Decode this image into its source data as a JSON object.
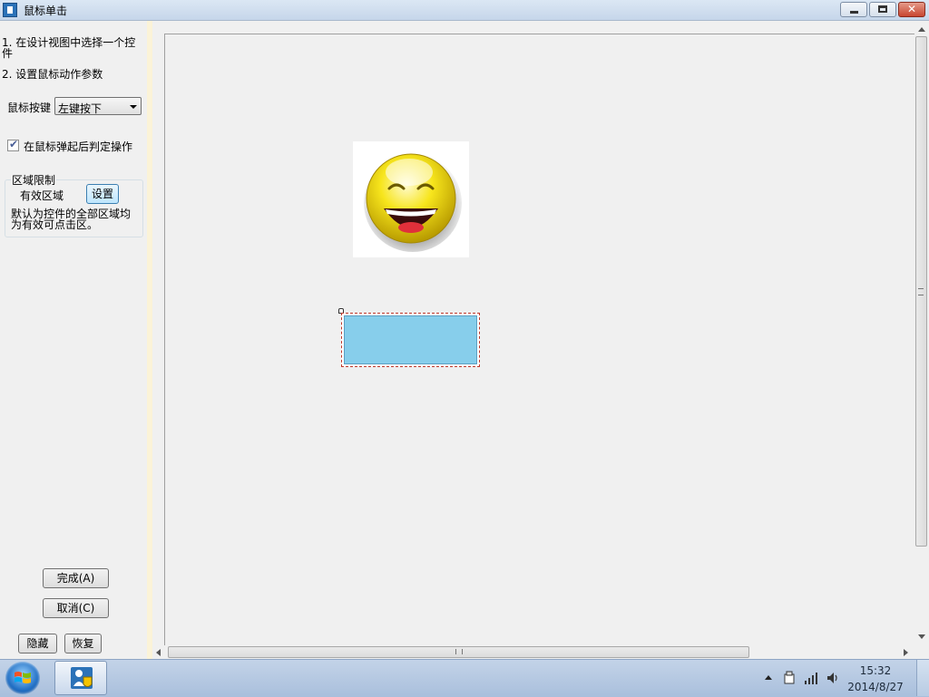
{
  "window": {
    "title": "鼠标单击"
  },
  "left_panel": {
    "step1": "1. 在设计视图中选择一个控件",
    "step2": "2. 设置鼠标动作参数",
    "mouse_key_label": "鼠标按键",
    "mouse_key_value": "左键按下",
    "release_checkbox_label": "在鼠标弹起后判定操作",
    "release_checked": true,
    "region_group_title": "区域限制",
    "valid_region_label": "有效区域",
    "set_button": "设置",
    "region_desc": "默认为控件的全部区域均为有效可点击区。",
    "finish_button": "完成(A)",
    "cancel_button": "取消(C)",
    "hide_button": "隐藏",
    "restore_button": "恢复"
  },
  "canvas": {
    "rect_fill": "#87ceeb",
    "rect_selection_border": "#c0392b"
  },
  "taskbar": {
    "time": "15:32",
    "date": "2014/8/27"
  },
  "icons": [
    "app-icon",
    "smiley-icon",
    "windows-start-icon",
    "app-task-icon",
    "usb-icon",
    "signal-icon",
    "volume-icon"
  ]
}
